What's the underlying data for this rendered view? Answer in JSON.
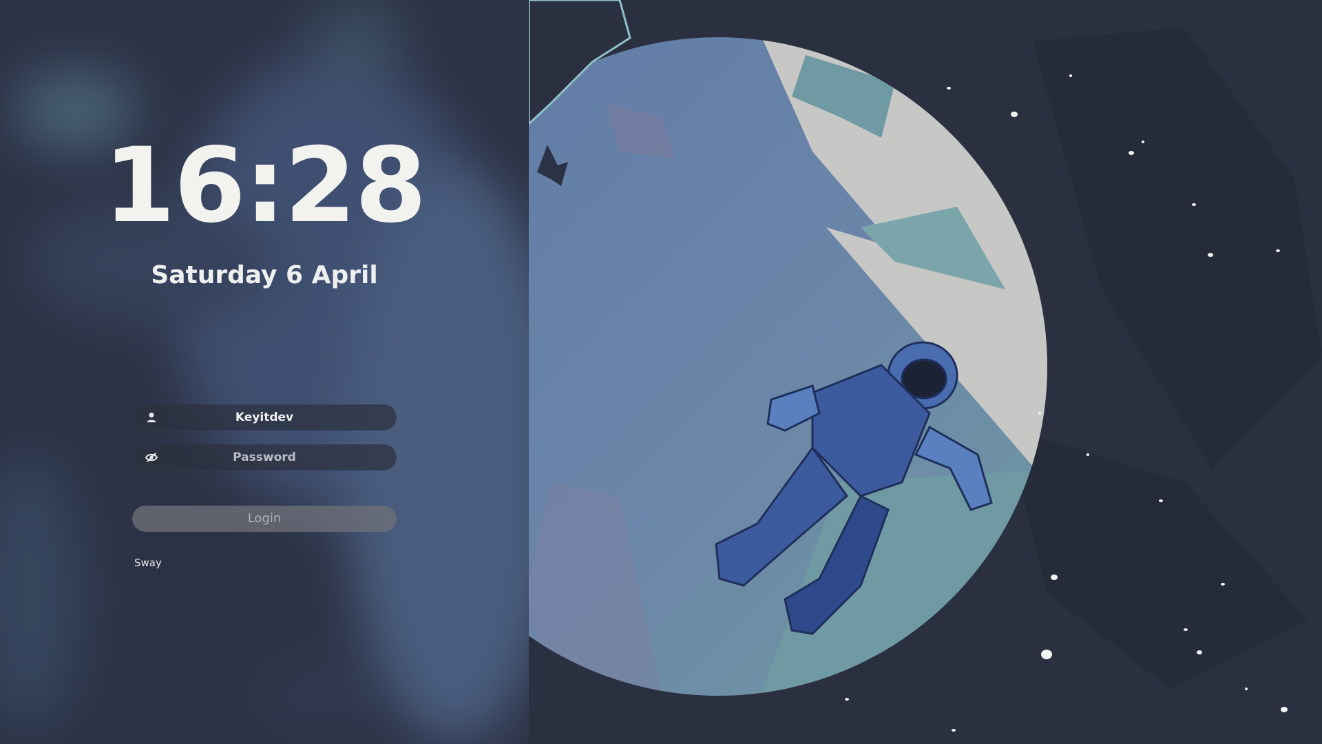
{
  "clock": {
    "time": "16:28"
  },
  "date": {
    "text": "Saturday 6 April"
  },
  "user": {
    "name": "Keyitdev",
    "icon": "user-icon"
  },
  "password": {
    "placeholder": "Password",
    "icon": "eye-off-icon"
  },
  "login": {
    "label": "Login"
  },
  "session": {
    "name": "Sway"
  },
  "wallpaper": {
    "subject": "astronaut-planet-illustration"
  },
  "colors": {
    "background": "#2b3040",
    "planet_blue": "#5f7ba6",
    "planet_teal": "#6f9aa3",
    "planet_light": "#c6c6c6",
    "astronaut_blue": "#3b5b9e",
    "text": "#f2f2ee"
  }
}
